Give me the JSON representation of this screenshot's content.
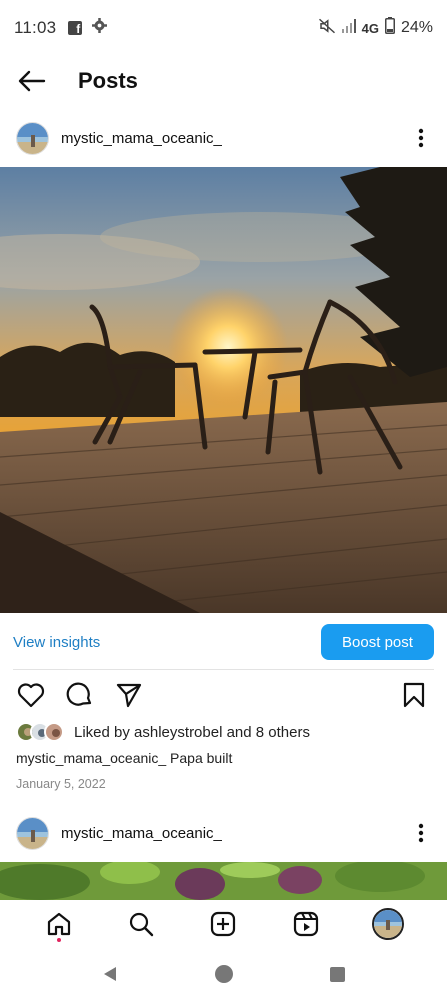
{
  "status_bar": {
    "time": "11:03",
    "network": "4G",
    "battery": "24%",
    "icons": [
      "facebook-icon",
      "settings-gear-icon",
      "mute-icon",
      "signal-icon",
      "battery-icon"
    ]
  },
  "header": {
    "title": "Posts",
    "back_icon": "arrow-left-icon"
  },
  "post": {
    "username": "mystic_mama_oceanic_",
    "image_alt": "sunset-deck-chairs-photo",
    "view_insights": "View insights",
    "boost_label": "Boost post",
    "liked_by": "Liked by ashleystrobel and 8 others",
    "caption": "mystic_mama_oceanic_ Papa built",
    "date": "January 5, 2022",
    "action_icons": [
      "heart-icon",
      "comment-icon",
      "send-icon",
      "bookmark-icon"
    ]
  },
  "next_post": {
    "username": "mystic_mama_oceanic_"
  },
  "bottom_nav": {
    "items": [
      "home-icon",
      "search-icon",
      "create-icon",
      "reels-icon",
      "profile-avatar"
    ],
    "active": "home-icon"
  },
  "system_nav": {
    "items": [
      "back-triangle-icon",
      "home-circle-icon",
      "recents-square-icon"
    ]
  },
  "colors": {
    "link": "#1f7fc4",
    "boost_button": "#1a9cf0",
    "notification_dot": "#e0245e"
  }
}
